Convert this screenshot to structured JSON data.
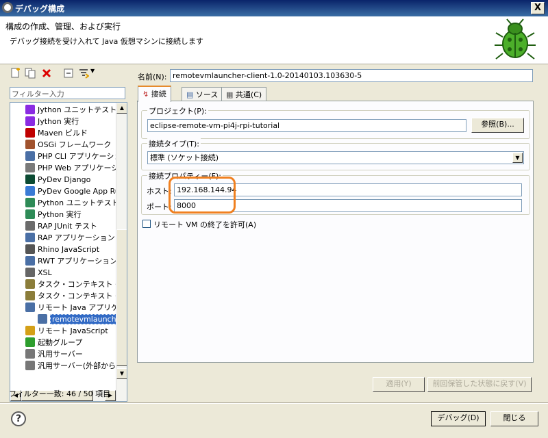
{
  "window": {
    "title": "デバッグ構成",
    "close_label": "X"
  },
  "header": {
    "title": "構成の作成、管理、および実行",
    "description": "デバッグ接続を受け入れて Java 仮想マシンに接続します"
  },
  "left": {
    "filter_placeholder": "フィルター入力",
    "tree_items": [
      {
        "label": "Jython ユニットテスト",
        "icon": "jython-test-icon",
        "color": "#8a2be2"
      },
      {
        "label": "Jython 実行",
        "icon": "jython-run-icon",
        "color": "#8a2be2"
      },
      {
        "label": "Maven ビルド",
        "icon": "maven-icon",
        "color": "#c00000"
      },
      {
        "label": "OSGi フレームワーク",
        "icon": "osgi-icon",
        "color": "#a0522d"
      },
      {
        "label": "PHP CLI アプリケーション",
        "icon": "php-icon",
        "color": "#4a6fa5"
      },
      {
        "label": "PHP Web アプリケーション",
        "icon": "php-web-icon",
        "color": "#7a7a7a"
      },
      {
        "label": "PyDev Django",
        "icon": "django-icon",
        "color": "#0c4b33"
      },
      {
        "label": "PyDev Google App Ru",
        "icon": "google-app-icon",
        "color": "#3a7bd5"
      },
      {
        "label": "Python ユニットテスト",
        "icon": "python-test-icon",
        "color": "#2e8b57"
      },
      {
        "label": "Python 実行",
        "icon": "python-run-icon",
        "color": "#2e8b57"
      },
      {
        "label": "RAP JUnit テスト",
        "icon": "rap-junit-icon",
        "color": "#6b6b6b"
      },
      {
        "label": "RAP アプリケーション",
        "icon": "rap-app-icon",
        "color": "#4a6fa5"
      },
      {
        "label": "Rhino JavaScript",
        "icon": "rhino-icon",
        "color": "#555555"
      },
      {
        "label": "RWT アプリケーション",
        "icon": "rwt-icon",
        "color": "#4a6fa5"
      },
      {
        "label": "XSL",
        "icon": "xsl-icon",
        "color": "#666666"
      },
      {
        "label": "タスク・コンテキスト・テスト",
        "icon": "task-test-icon",
        "color": "#8b7d3a"
      },
      {
        "label": "タスク・コンテキスト・プラグ",
        "icon": "task-plugin-icon",
        "color": "#8b7d3a"
      },
      {
        "label": "リモート Java アプリケー",
        "icon": "remote-java-icon",
        "color": "#4a6fa5"
      },
      {
        "label": "remotevmlauncher",
        "icon": "launch-config-icon",
        "color": "#4a6fa5",
        "selected": true,
        "child": true
      },
      {
        "label": "リモート JavaScript",
        "icon": "remote-js-icon",
        "color": "#d4a017"
      },
      {
        "label": "起動グループ",
        "icon": "launch-group-icon",
        "color": "#2e9e2e"
      },
      {
        "label": "汎用サーバー",
        "icon": "server-icon",
        "color": "#777777"
      },
      {
        "label": "汎用サーバー(外部から",
        "icon": "server-external-icon",
        "color": "#777777"
      }
    ],
    "status": "フィルター一致: 46 / 50 項目"
  },
  "right": {
    "name_label": "名前(N):",
    "name_value": "remotevmlauncher-client-1.0-20140103.103630-5",
    "tabs": [
      {
        "label": "接続",
        "icon": "connect-icon"
      },
      {
        "label": "ソース",
        "icon": "source-icon"
      },
      {
        "label": "共通(C)",
        "icon": "common-icon"
      }
    ],
    "project": {
      "group_label": "プロジェクト(P):",
      "value": "eclipse-remote-vm-pi4j-rpi-tutorial",
      "browse_label": "参照(B)..."
    },
    "connection_type": {
      "group_label": "接続タイプ(T):",
      "selected": "標準 (ソケット接続)"
    },
    "connection_props": {
      "group_label": "接続プロパティー(F):",
      "host_label": "ホスト:",
      "host_value": "192.168.144.94",
      "port_label": "ポート:",
      "port_value": "8000"
    },
    "allow_terminate_label": "リモート VM の終了を許可(A)",
    "apply_label": "適用(Y)",
    "revert_label": "前回保管した状態に戻す(V)"
  },
  "footer": {
    "help_label": "?",
    "debug_label": "デバッグ(D)",
    "close_label": "閉じる"
  },
  "colors": {
    "highlight": "#f08020",
    "selection": "#316ac5"
  }
}
